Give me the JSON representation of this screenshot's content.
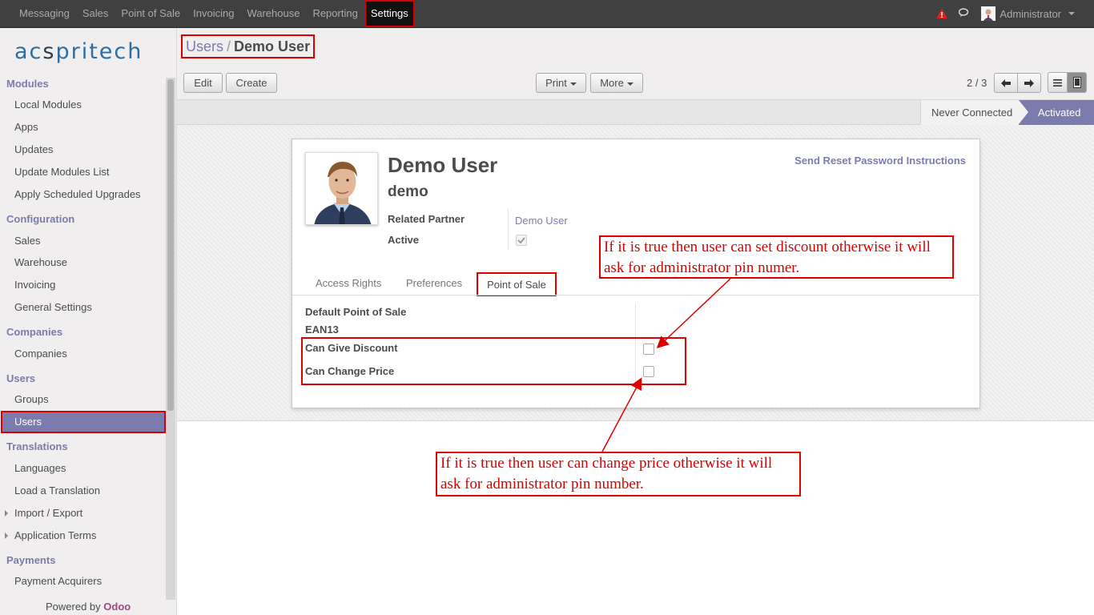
{
  "topbar": {
    "menu": [
      "Messaging",
      "Sales",
      "Point of Sale",
      "Invoicing",
      "Warehouse",
      "Reporting",
      "Settings"
    ],
    "active": "Settings",
    "user_name": "Administrator",
    "icons": [
      "warning-icon",
      "chat-icon",
      "user-avatar"
    ]
  },
  "sidebar": {
    "logo": {
      "left": "ac",
      "mid": "s",
      "right": "pritech"
    },
    "sections": [
      {
        "title": "Modules",
        "items": [
          "Local Modules",
          "Apps",
          "Updates",
          "Update Modules List",
          "Apply Scheduled Upgrades"
        ]
      },
      {
        "title": "Configuration",
        "items": [
          "Sales",
          "Warehouse",
          "Invoicing",
          "General Settings"
        ]
      },
      {
        "title": "Companies",
        "items": [
          "Companies"
        ]
      },
      {
        "title": "Users",
        "items": [
          "Groups",
          "Users"
        ]
      },
      {
        "title": "Translations",
        "items": [
          "Languages",
          "Load a Translation",
          "Import / Export",
          "Application Terms"
        ]
      },
      {
        "title": "Payments",
        "items": [
          "Payment Acquirers"
        ]
      }
    ],
    "active_item": "Users",
    "powered_prefix": "Powered by",
    "powered_brand": "Odoo"
  },
  "header": {
    "breadcrumb_parent": "Users",
    "breadcrumb_sep": "/",
    "breadcrumb_current": "Demo User",
    "buttons": {
      "edit": "Edit",
      "create": "Create",
      "print": "Print",
      "more": "More"
    },
    "pager": "2 / 3"
  },
  "statusbar": {
    "never": "Never Connected",
    "activated": "Activated",
    "current": "Activated"
  },
  "form": {
    "name": "Demo User",
    "login": "demo",
    "reset_link": "Send Reset Password Instructions",
    "related_partner_label": "Related Partner",
    "related_partner_value": "Demo User",
    "active_label": "Active",
    "active_checked": true,
    "tabs": [
      "Access Rights",
      "Preferences",
      "Point of Sale"
    ],
    "active_tab": "Point of Sale",
    "pos_fields": {
      "default_pos": "Default Point of Sale",
      "ean13": "EAN13",
      "can_give_discount": "Can Give Discount",
      "can_change_price": "Can Change Price"
    },
    "can_give_discount_checked": false,
    "can_change_price_checked": false
  },
  "annotations": {
    "discount_note": "If it is true then user can set discount otherwise it will ask for administrator pin numer.",
    "price_note": "If it is true then user can change price otherwise it will ask for administrator pin number."
  },
  "colors": {
    "accent": "#7c7bad",
    "highlight": "#dd0000",
    "topbar": "#404040",
    "brand_odoo": "#a24689"
  }
}
